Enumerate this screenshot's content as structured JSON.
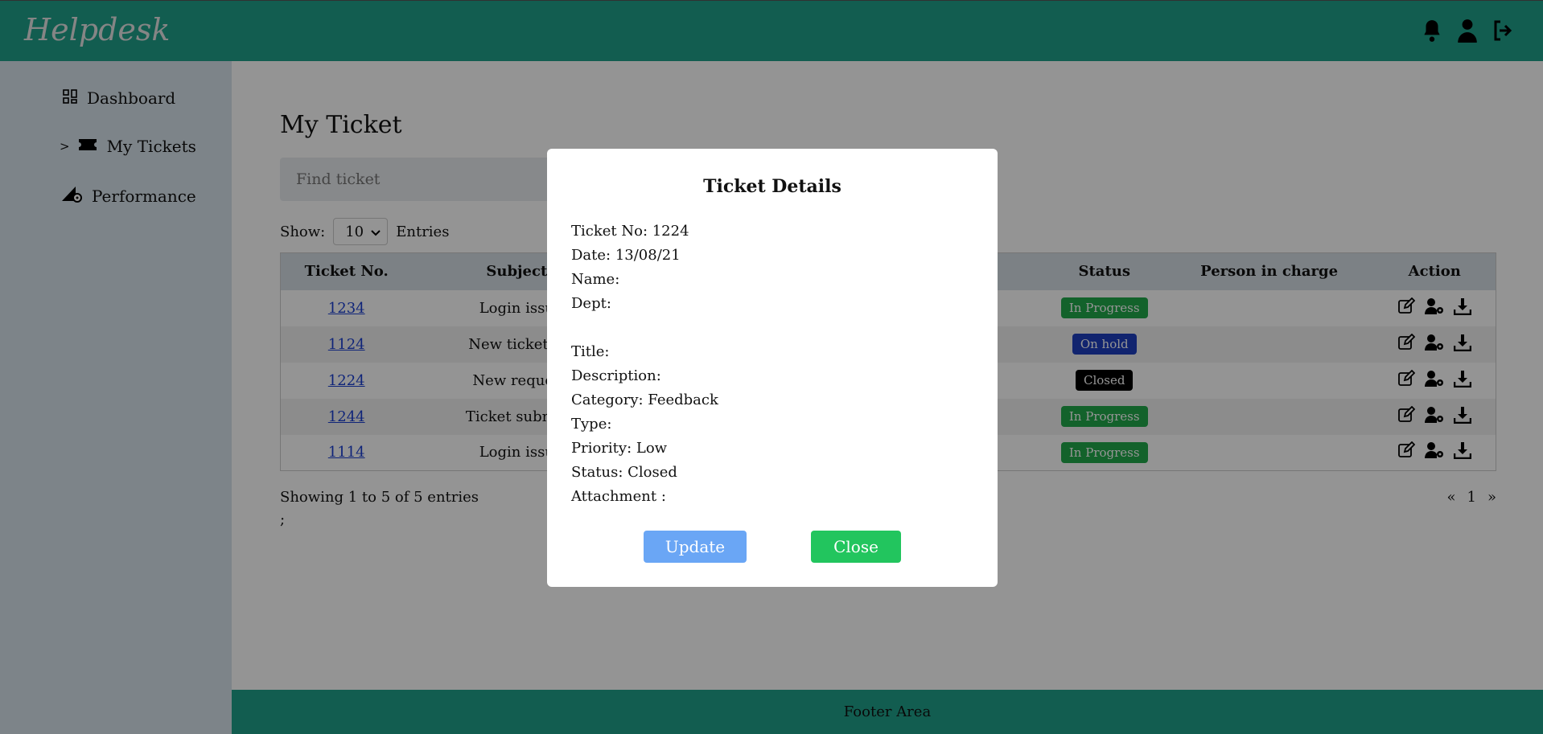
{
  "app": {
    "brand": "Helpdesk"
  },
  "sidebar": {
    "items": [
      {
        "label": "Dashboard",
        "active": false
      },
      {
        "label": "My Tickets",
        "active": true,
        "marker": ">"
      },
      {
        "label": "Performance",
        "active": false
      }
    ]
  },
  "main": {
    "title": "My Ticket",
    "search_placeholder": "Find ticket",
    "show_label": "Show:",
    "entries_value": "10",
    "entries_label": "Entries",
    "columns": [
      "Ticket No.",
      "Subject",
      "Status",
      "Person in charge",
      "Action"
    ],
    "rows": [
      {
        "no": "1234",
        "subject": "Login issu",
        "status": "In Progress",
        "status_color": "#22a94b",
        "person": ""
      },
      {
        "no": "1124",
        "subject": "New ticket is",
        "status": "On hold",
        "status_color": "#1e3fbf",
        "person": ""
      },
      {
        "no": "1224",
        "subject": "New reques",
        "status": "Closed",
        "status_color": "#000000",
        "person": ""
      },
      {
        "no": "1244",
        "subject": "Ticket submis",
        "status": "In Progress",
        "status_color": "#22a94b",
        "person": ""
      },
      {
        "no": "1114",
        "subject": "Login issu",
        "status": "In Progress",
        "status_color": "#22a94b",
        "person": ""
      }
    ],
    "showing_text": "Showing 1 to 5 of 5 entries",
    "stray_text": ";",
    "pager": {
      "prev": "«",
      "page": "1",
      "next": "»"
    }
  },
  "footer": {
    "text": "Footer Area"
  },
  "modal": {
    "title": "Ticket Details",
    "fields": {
      "ticket_no": "Ticket No: 1224",
      "date": "Date: 13/08/21",
      "name": "Name:",
      "dept": "Dept:",
      "title": "Title:",
      "description": "Description:",
      "category": "Category: Feedback",
      "type": "Type:",
      "priority": "Priority: Low",
      "status": "Status: Closed",
      "attachment": "Attachment :"
    },
    "update_label": "Update",
    "close_label": "Close"
  },
  "colors": {
    "header": "#1fa08a",
    "sidebar": "#d8e3ec",
    "update": "#6aa6f5",
    "close": "#22c55e"
  }
}
